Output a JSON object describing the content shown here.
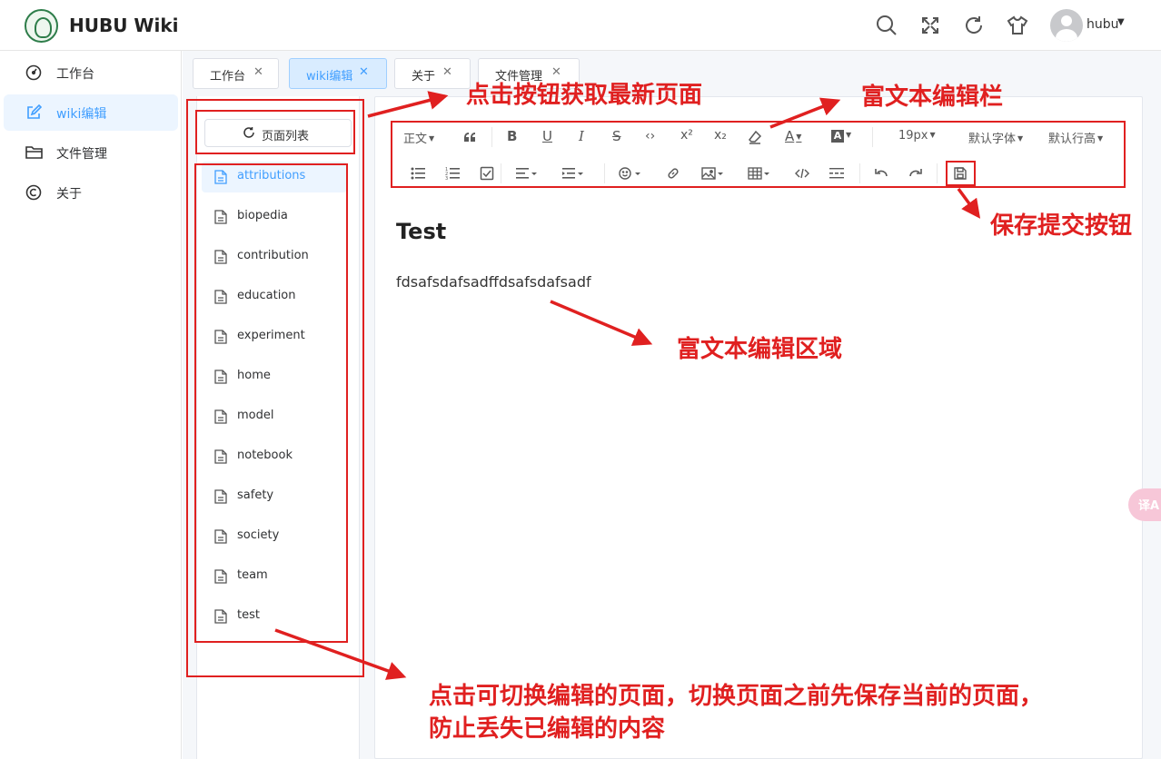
{
  "header": {
    "app_title": "HUBU Wiki",
    "username": "hubu",
    "icons": [
      "search-icon",
      "fullscreen-icon",
      "refresh-icon",
      "theme-shirt-icon"
    ]
  },
  "sidebar": {
    "items": [
      {
        "label": "工作台",
        "icon": "dashboard-icon",
        "active": false
      },
      {
        "label": "wiki编辑",
        "icon": "edit-icon",
        "active": true
      },
      {
        "label": "文件管理",
        "icon": "folder-icon",
        "active": false
      },
      {
        "label": "关于",
        "icon": "copyright-icon",
        "active": false
      }
    ]
  },
  "tabs": [
    {
      "label": "工作台",
      "active": false
    },
    {
      "label": "wiki编辑",
      "active": true
    },
    {
      "label": "关于",
      "active": false
    },
    {
      "label": "文件管理",
      "active": false
    }
  ],
  "page_list": {
    "button_label": "页面列表",
    "items": [
      "attributions",
      "biopedia",
      "contribution",
      "education",
      "experiment",
      "home",
      "model",
      "notebook",
      "safety",
      "society",
      "team",
      "test"
    ],
    "active_index": 0
  },
  "toolbar": {
    "paragraph_select": "正文",
    "font_size": "19px",
    "font_family": "默认字体",
    "line_height": "默认行高"
  },
  "document": {
    "title": "Test",
    "body": "fdsafsdafsadffdsafsdafsadf"
  },
  "translate_button": "译A",
  "annotations": {
    "refresh_tip": "点击按钮获取最新页面",
    "toolbar_tip": "富文本编辑栏",
    "save_tip": "保存提交按钮",
    "editor_tip": "富文本编辑区域",
    "switch_tip_line1": "点击可切换编辑的页面，切换页面之前先保存当前的页面，",
    "switch_tip_line2": "防止丢失已编辑的内容"
  },
  "colors": {
    "accent": "#409eff",
    "annotation_red": "#e02020",
    "active_bg": "#ecf5ff"
  }
}
